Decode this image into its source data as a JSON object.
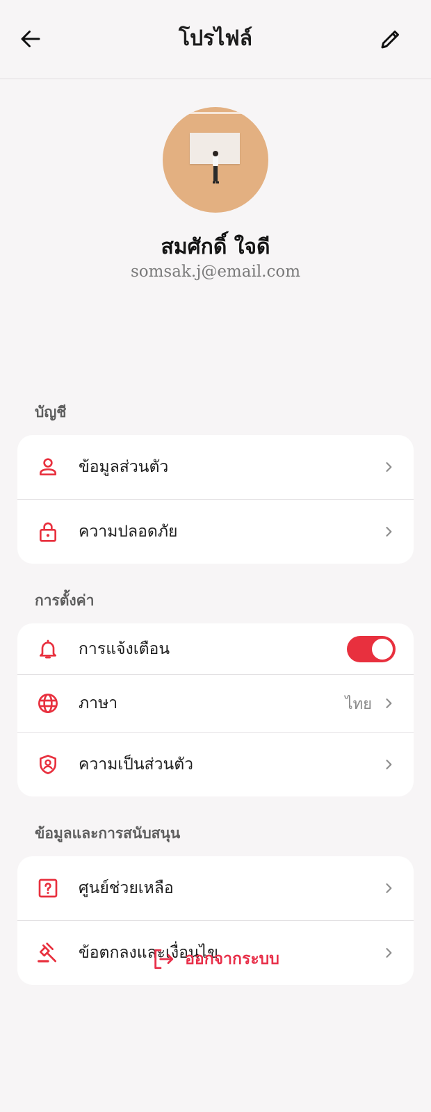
{
  "header": {
    "title": "โปรไฟล์"
  },
  "profile": {
    "name": "สมศักดิ์ ใจดี",
    "email": "somsak.j@email.com"
  },
  "sections": {
    "account": {
      "title": "บัญชี",
      "items": [
        {
          "label": "ข้อมูลส่วนตัว",
          "icon": "person-icon"
        },
        {
          "label": "ความปลอดภัย",
          "icon": "lock-icon"
        }
      ]
    },
    "settings": {
      "title": "การตั้งค่า",
      "items": [
        {
          "label": "การแจ้งเตือน",
          "icon": "bell-icon",
          "toggle_on": true
        },
        {
          "label": "ภาษา",
          "icon": "globe-icon",
          "value": "ไทย"
        },
        {
          "label": "ความเป็นส่วนตัว",
          "icon": "shield-icon"
        }
      ]
    },
    "support": {
      "title": "ข้อมูลและการสนับสนุน",
      "items": [
        {
          "label": "ศูนย์ช่วยเหลือ",
          "icon": "help-icon"
        },
        {
          "label": "ข้อตกลงและเงื่อนไข",
          "icon": "gavel-icon"
        }
      ]
    }
  },
  "logout": {
    "label": "ออกจากระบบ"
  },
  "colors": {
    "accent": "#e8303e",
    "background": "#f7f5f6",
    "avatar_bg": "#e3b081"
  }
}
